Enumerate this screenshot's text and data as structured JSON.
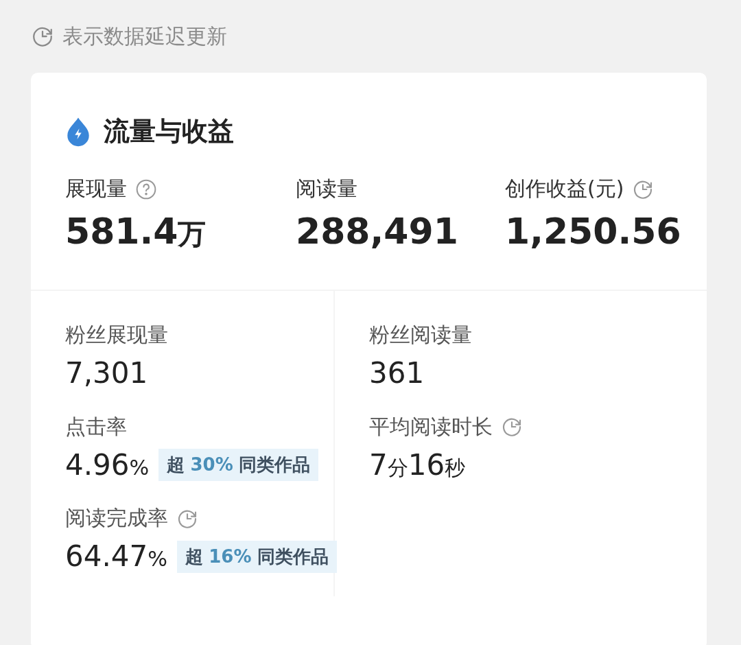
{
  "notice": {
    "text": "表示数据延迟更新"
  },
  "card": {
    "title": "流量与收益",
    "top_metrics": [
      {
        "label": "展现量",
        "kind": "explained",
        "value": [
          {
            "text": "581.4",
            "kind": "number"
          },
          {
            "text": "万",
            "kind": "unit"
          }
        ]
      },
      {
        "label": "阅读量",
        "kind": "plain",
        "value": [
          {
            "text": "288,491",
            "kind": "number"
          }
        ]
      },
      {
        "label": "创作收益(元)",
        "kind": "delayed",
        "value": [
          {
            "text": "1,250.56",
            "kind": "number"
          }
        ]
      }
    ],
    "left_metrics": [
      {
        "label": "粉丝展现量",
        "kind": "plain",
        "value": [
          {
            "text": "7,301",
            "kind": "number"
          }
        ]
      },
      {
        "label": "点击率",
        "kind": "plain",
        "value": [
          {
            "text": "4.96",
            "kind": "number"
          },
          {
            "text": "%",
            "kind": "unit"
          }
        ],
        "badge": {
          "prefix": "超",
          "value": "30%",
          "suffix": "同类作品"
        }
      },
      {
        "label": "阅读完成率",
        "kind": "delayed",
        "value": [
          {
            "text": "64.47",
            "kind": "number"
          },
          {
            "text": "%",
            "kind": "unit"
          }
        ],
        "badge": {
          "prefix": "超",
          "value": "16%",
          "suffix": "同类作品"
        }
      }
    ],
    "right_metrics": [
      {
        "label": "粉丝阅读量",
        "kind": "plain",
        "value": [
          {
            "text": "361",
            "kind": "number"
          }
        ]
      },
      {
        "label": "平均阅读时长",
        "kind": "delayed",
        "value": [
          {
            "text": "7",
            "kind": "number"
          },
          {
            "text": "分",
            "kind": "unit"
          },
          {
            "text": "16",
            "kind": "number"
          },
          {
            "text": "秒",
            "kind": "unit"
          }
        ]
      }
    ]
  }
}
